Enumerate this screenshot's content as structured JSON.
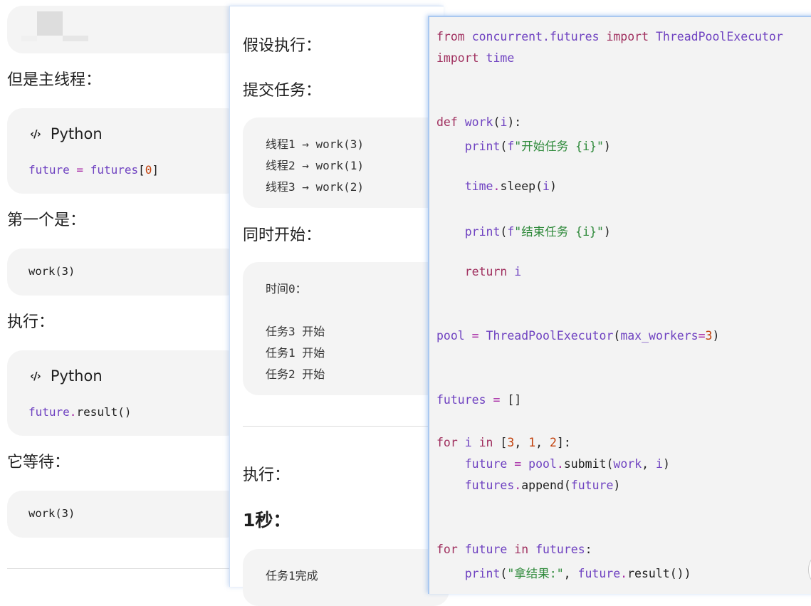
{
  "panel1": {
    "heading_main_thread": "但是主线程：",
    "lang_label": "Python",
    "code1": {
      "v1": "future",
      "op": " = ",
      "v2": "futures",
      "b1": "[",
      "n": "0",
      "b2": "]"
    },
    "heading_first": "第一个是：",
    "code_work3_a": "work(3)",
    "heading_exec": "执行：",
    "code2": {
      "v": "future",
      "dot": ".",
      "rest": "result()"
    },
    "heading_wait": "它等待：",
    "code_work3_b": "work(3)"
  },
  "panel2": {
    "heading_assume": "假设执行：",
    "heading_submit": "提交任务：",
    "threads": [
      "线程1 → work(3)",
      "线程2 → work(1)",
      "线程3 → work(2)"
    ],
    "heading_simul": "同时开始：",
    "time0": "时间0：",
    "starts": [
      "任务3 开始",
      "任务1 开始",
      "任务2 开始"
    ],
    "heading_exec": "执行：",
    "heading_1s": "1秒：",
    "done1": "任务1完成"
  },
  "panel3": {
    "t_from": "from",
    "t_mod": "concurrent.futures",
    "t_import": "import",
    "t_tpe": "ThreadPoolExecutor",
    "t_time": "time",
    "t_def": "def",
    "t_work": "work",
    "t_arg_i": "i",
    "t_print": "print",
    "t_f": "f",
    "t_str_start": "\"开始任务 {i}\"",
    "t_sleep_obj": "time",
    "t_sleep_fn": "sleep",
    "t_str_end": "\"结束任务 {i}\"",
    "t_return": "return",
    "t_pool": "pool",
    "t_eq": " = ",
    "t_maxw": "max_workers",
    "t_three": "3",
    "t_futures": "futures",
    "t_empty": "[]",
    "t_for": "for",
    "t_in": "in",
    "t_n3": "3",
    "t_n1": "1",
    "t_n2": "2",
    "t_future": "future",
    "t_submit": "submit",
    "t_append": "append",
    "t_str_result": "\"拿结果:\"",
    "t_result": "result"
  }
}
